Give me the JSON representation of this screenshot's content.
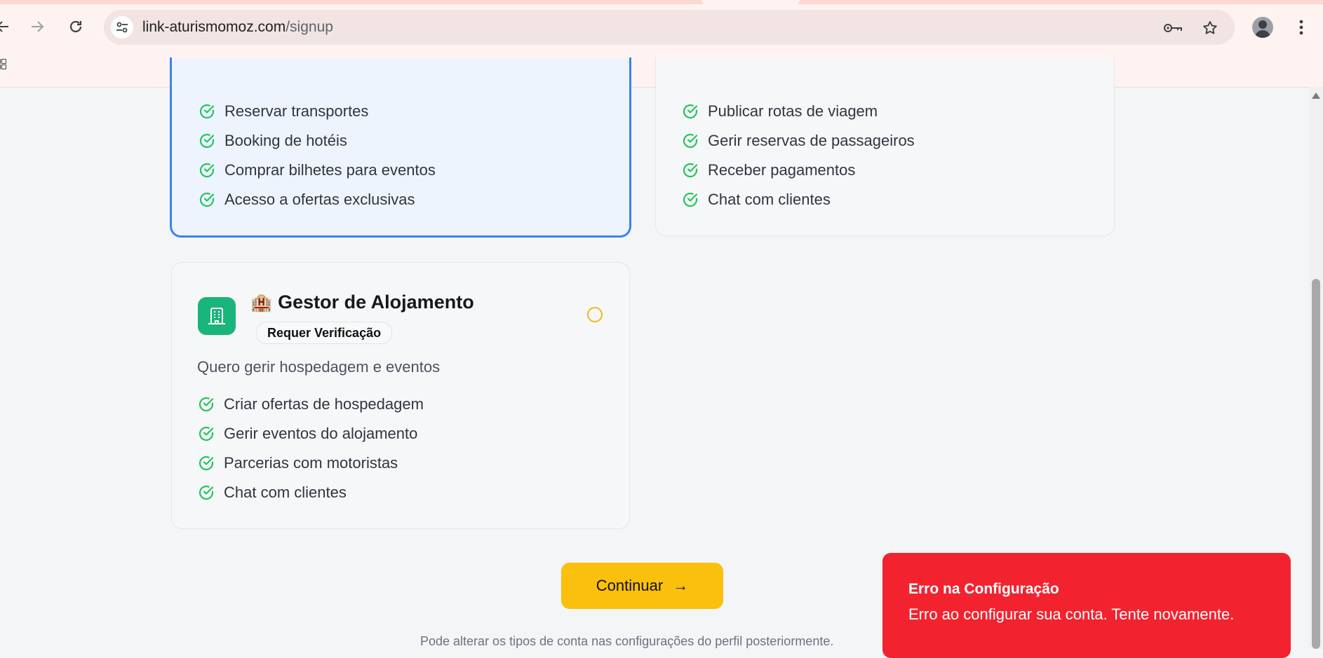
{
  "browser": {
    "url_host": "link-aturismomoz.com",
    "url_path": "/signup",
    "icons": {
      "back": "back-arrow-icon",
      "forward": "forward-arrow-icon",
      "reload": "reload-icon",
      "site_info": "tune-icon",
      "password": "key-icon",
      "bookmark": "star-icon",
      "menu": "kebab-menu-icon"
    }
  },
  "cards": {
    "traveler": {
      "features": [
        "Reservar transportes",
        "Booking de hotéis",
        "Comprar bilhetes para eventos",
        "Acesso a ofertas exclusivas"
      ]
    },
    "driver": {
      "features": [
        "Publicar rotas de viagem",
        "Gerir reservas de passageiros",
        "Receber pagamentos",
        "Chat com clientes"
      ]
    },
    "host": {
      "emoji": "🏨",
      "title": "Gestor de Alojamento",
      "badge": "Requer Verificação",
      "description": "Quero gerir hospedagem e eventos",
      "features": [
        "Criar ofertas de hospedagem",
        "Gerir eventos do alojamento",
        "Parcerias com motoristas",
        "Chat com clientes"
      ]
    }
  },
  "actions": {
    "continue_label": "Continuar",
    "continue_arrow": "→"
  },
  "footnote": "Pode alterar os tipos de conta nas configurações do perfil posteriormente.",
  "toast": {
    "title": "Erro na Configuração",
    "message": "Erro ao configurar sua conta. Tente novamente."
  },
  "colors": {
    "accent": "#fbbf0d",
    "selected_border": "#3b82f6",
    "check": "#22c55e",
    "host_icon_bg": "#19b57a",
    "error": "#f2232f"
  }
}
